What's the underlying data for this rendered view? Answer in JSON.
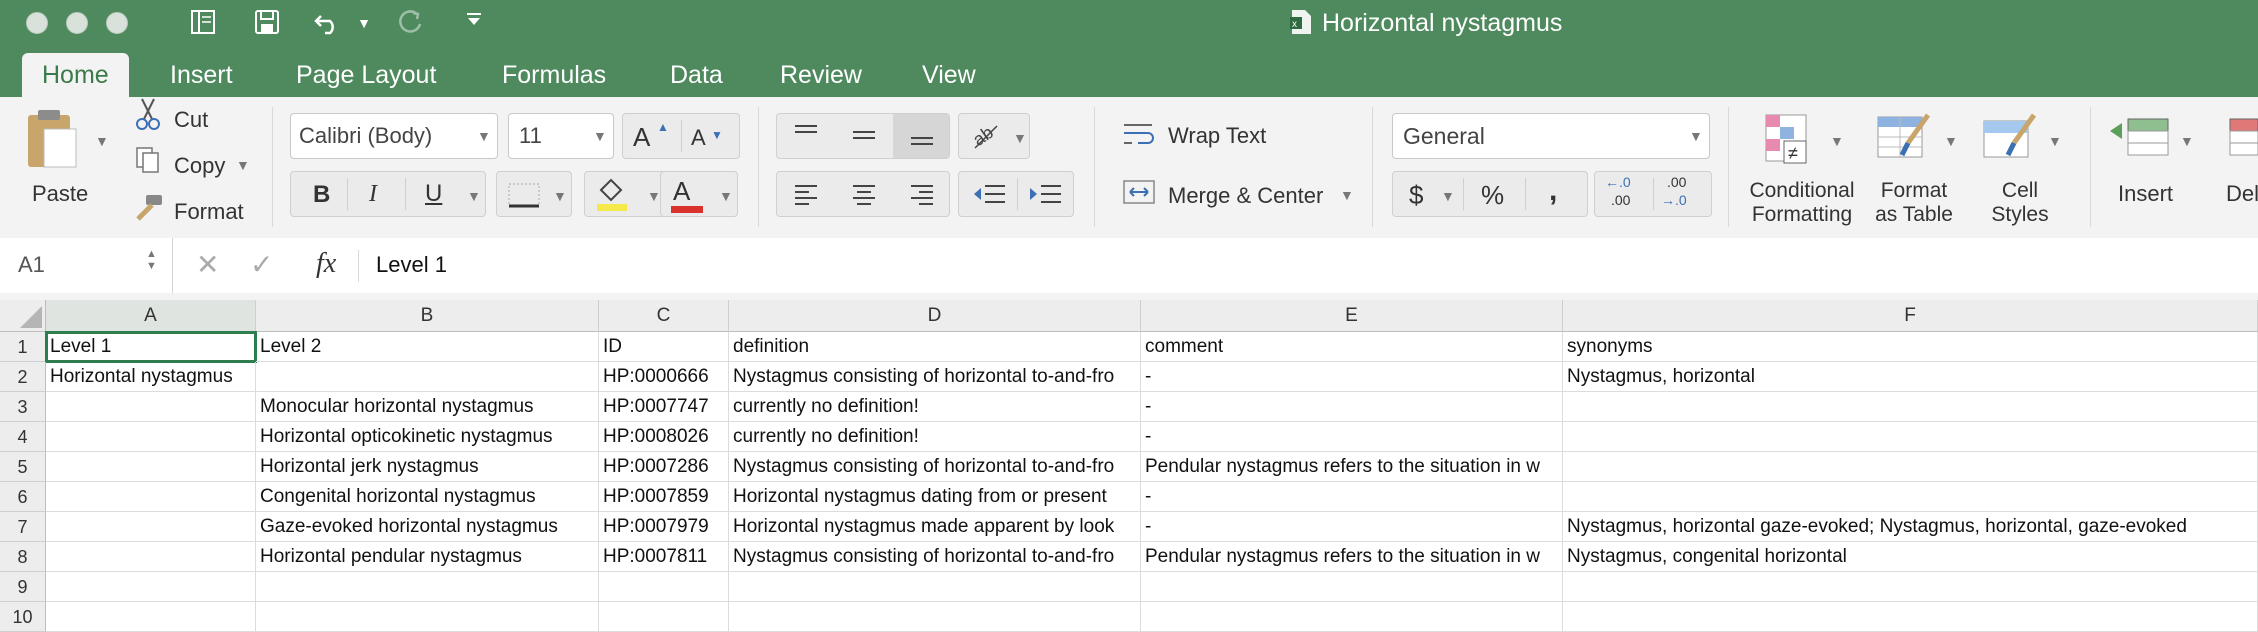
{
  "window": {
    "title": "Horizontal nystagmus"
  },
  "tabs": [
    {
      "label": "Home"
    },
    {
      "label": "Insert"
    },
    {
      "label": "Page Layout"
    },
    {
      "label": "Formulas"
    },
    {
      "label": "Data"
    },
    {
      "label": "Review"
    },
    {
      "label": "View"
    }
  ],
  "ribbon": {
    "paste": "Paste",
    "cut": "Cut",
    "copy": "Copy",
    "format": "Format",
    "font_name": "Calibri (Body)",
    "font_size": "11",
    "bold": "B",
    "italic": "I",
    "underline": "U",
    "grow_font": "A",
    "shrink_font": "A",
    "font_color_glyph": "A",
    "wrap_text": "Wrap Text",
    "merge_center": "Merge & Center",
    "number_format": "General",
    "currency": "$",
    "percent": "%",
    "comma": ",",
    "inc_decimal_top": "←.0",
    "inc_decimal_bottom": ".00",
    "dec_decimal_top": ".00",
    "dec_decimal_bottom": "→.0",
    "conditional_formatting_1": "Conditional",
    "conditional_formatting_2": "Formatting",
    "format_as_table_1": "Format",
    "format_as_table_2": "as Table",
    "cell_styles_1": "Cell",
    "cell_styles_2": "Styles",
    "insert": "Insert",
    "delete": "Dele"
  },
  "formula_bar": {
    "name_box": "A1",
    "fx": "fx",
    "content": "Level 1"
  },
  "colors": {
    "titlebar": "#4f8a5f",
    "fill_highlight": "#f5e84a",
    "font_red": "#d9312b"
  },
  "columns": [
    "A",
    "B",
    "C",
    "D",
    "E",
    "F"
  ],
  "rows": [
    {
      "num": "1",
      "cells": [
        "Level 1",
        "Level 2",
        "ID",
        "definition",
        "comment",
        "synonyms"
      ]
    },
    {
      "num": "2",
      "cells": [
        "Horizontal nystagmus",
        "",
        "HP:0000666",
        "Nystagmus consisting of horizontal to-and-fro",
        "-",
        "Nystagmus, horizontal"
      ]
    },
    {
      "num": "3",
      "cells": [
        "",
        "Monocular horizontal nystagmus",
        "HP:0007747",
        "currently no definition!",
        "-",
        ""
      ]
    },
    {
      "num": "4",
      "cells": [
        "",
        "Horizontal opticokinetic nystagmus",
        "HP:0008026",
        "currently no definition!",
        "-",
        ""
      ]
    },
    {
      "num": "5",
      "cells": [
        "",
        "Horizontal jerk nystagmus",
        "HP:0007286",
        "Nystagmus consisting of horizontal to-and-fro",
        "Pendular nystagmus refers to the situation in w",
        ""
      ]
    },
    {
      "num": "6",
      "cells": [
        "",
        "Congenital horizontal nystagmus",
        "HP:0007859",
        "Horizontal nystagmus dating from or present",
        "-",
        ""
      ]
    },
    {
      "num": "7",
      "cells": [
        "",
        "Gaze-evoked horizontal nystagmus",
        "HP:0007979",
        "Horizontal nystagmus made apparent by look",
        "-",
        "Nystagmus, horizontal gaze-evoked; Nystagmus, horizontal, gaze-evoked"
      ]
    },
    {
      "num": "8",
      "cells": [
        "",
        "Horizontal pendular nystagmus",
        "HP:0007811",
        "Nystagmus consisting of horizontal to-and-fro",
        "Pendular nystagmus refers to the situation in w",
        "Nystagmus, congenital horizontal"
      ]
    },
    {
      "num": "9",
      "cells": [
        "",
        "",
        "",
        "",
        "",
        ""
      ]
    },
    {
      "num": "10",
      "cells": [
        "",
        "",
        "",
        "",
        "",
        ""
      ]
    }
  ]
}
